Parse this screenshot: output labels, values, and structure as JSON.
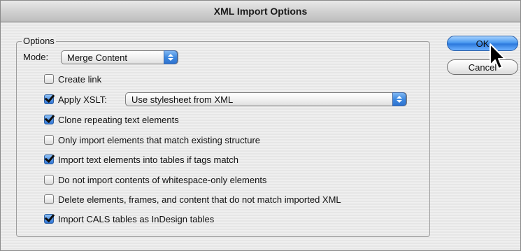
{
  "window": {
    "title": "XML Import Options"
  },
  "options_group": {
    "legend": "Options"
  },
  "mode": {
    "label": "Mode:",
    "selected": "Merge Content"
  },
  "xslt": {
    "selected": "Use stylesheet from XML"
  },
  "checkboxes": [
    {
      "label": "Create link",
      "checked": false
    },
    {
      "label": "Apply XSLT:",
      "checked": true
    },
    {
      "label": "Clone repeating text elements",
      "checked": true
    },
    {
      "label": "Only import elements that match existing structure",
      "checked": false
    },
    {
      "label": "Import text elements into tables if tags match",
      "checked": true
    },
    {
      "label": "Do not import contents of whitespace-only elements",
      "checked": false
    },
    {
      "label": "Delete elements, frames, and content that do not match imported XML",
      "checked": false
    },
    {
      "label": "Import CALS tables as InDesign tables",
      "checked": true
    }
  ],
  "buttons": {
    "ok": "OK",
    "cancel": "Cancel"
  },
  "colors": {
    "accent": "#3d88e0"
  }
}
